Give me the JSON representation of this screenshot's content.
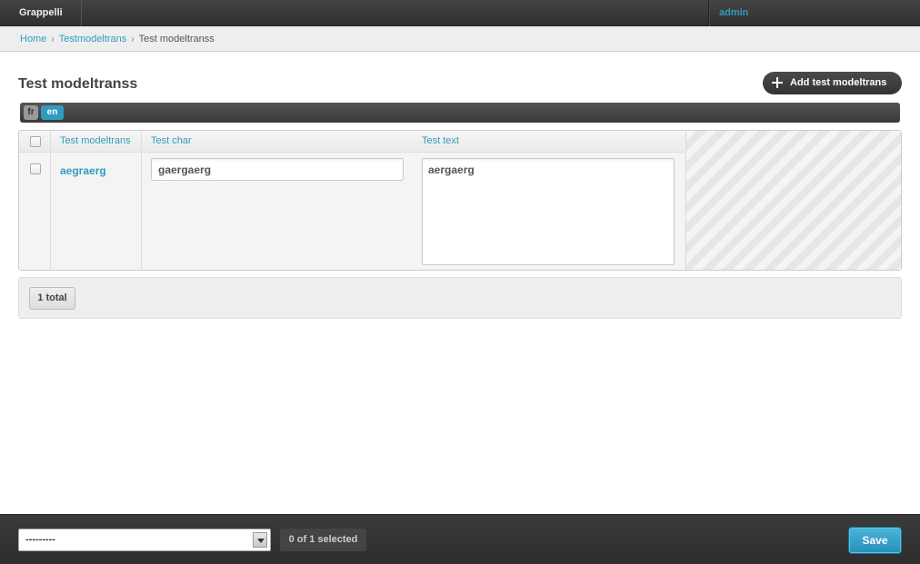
{
  "header": {
    "brand": "Grappelli",
    "user": "admin"
  },
  "breadcrumbs": {
    "home": "Home",
    "sep1": "›",
    "app": "Testmodeltrans",
    "sep2": "›",
    "current": "Test modeltranss"
  },
  "page": {
    "title": "Test modeltranss",
    "add_button": "Add test modeltrans"
  },
  "languages": {
    "tabs": [
      "fr",
      "en"
    ],
    "active": "en"
  },
  "table": {
    "columns": [
      "Test modeltrans",
      "Test char",
      "Test text"
    ],
    "rows": [
      {
        "name": "aegraerg",
        "test_char": "gaergaerg",
        "test_text": "aergaerg"
      }
    ]
  },
  "paginator": {
    "total": "1 total"
  },
  "footer": {
    "action_select": "---------",
    "selected_counter": "0 of 1 selected",
    "save_label": "Save"
  },
  "colors": {
    "accent": "#309bbf",
    "header_bg": "#333333",
    "save_bg": "#2a9fd0"
  }
}
